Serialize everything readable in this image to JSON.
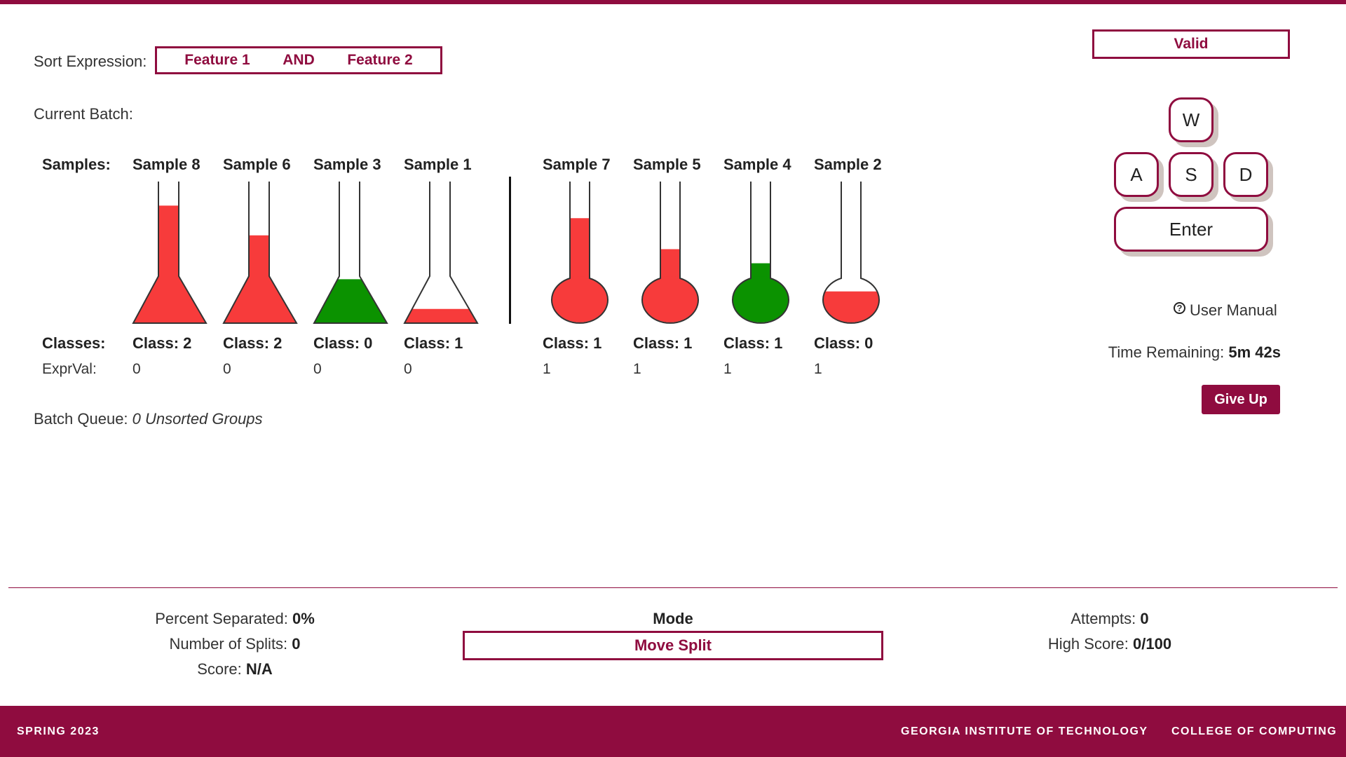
{
  "sort_expression": {
    "label": "Sort Expression:",
    "tokens": [
      "Feature 1",
      "AND",
      "Feature 2"
    ]
  },
  "batch": {
    "label": "Current Batch:",
    "samples_label": "Samples:",
    "classes_label": "Classes:",
    "exprval_label": "ExprVal:",
    "left_group": [
      {
        "name": "Sample 8",
        "class": "Class: 2",
        "exprval": "0",
        "shape": "cone",
        "color": "#f73b3b",
        "fill": 0.83
      },
      {
        "name": "Sample 6",
        "class": "Class: 2",
        "exprval": "0",
        "shape": "cone",
        "color": "#f73b3b",
        "fill": 0.62
      },
      {
        "name": "Sample 3",
        "class": "Class: 0",
        "exprval": "0",
        "shape": "cone",
        "color": "#0b9200",
        "fill": 0.31
      },
      {
        "name": "Sample 1",
        "class": "Class: 1",
        "exprval": "0",
        "shape": "cone",
        "color": "#f73b3b",
        "fill": 0.1
      }
    ],
    "right_group": [
      {
        "name": "Sample 7",
        "class": "Class: 1",
        "exprval": "1",
        "shape": "bulb",
        "color": "#f73b3b",
        "fill": 0.74
      },
      {
        "name": "Sample 5",
        "class": "Class: 1",
        "exprval": "1",
        "shape": "bulb",
        "color": "#f73b3b",
        "fill": 0.52
      },
      {
        "name": "Sample 4",
        "class": "Class: 1",
        "exprval": "1",
        "shape": "bulb",
        "color": "#0b9200",
        "fill": 0.42
      },
      {
        "name": "Sample 2",
        "class": "Class: 0",
        "exprval": "1",
        "shape": "bulb",
        "color": "#f73b3b",
        "fill": 0.22
      }
    ]
  },
  "queue": {
    "label": "Batch Queue:",
    "value": "0 Unsorted Groups"
  },
  "status": {
    "valid_label": "Valid"
  },
  "keys": {
    "w": "W",
    "a": "A",
    "s": "S",
    "d": "D",
    "enter": "Enter"
  },
  "manual": {
    "icon": "help-circle-icon",
    "label": "User Manual"
  },
  "timer": {
    "label": "Time Remaining:",
    "value": "5m 42s"
  },
  "give_up_label": "Give Up",
  "stats": {
    "percent_label": "Percent Separated:",
    "percent_value": "0%",
    "splits_label": "Number of Splits:",
    "splits_value": "0",
    "score_label": "Score:",
    "score_value": "N/A",
    "attempts_label": "Attempts:",
    "attempts_value": "0",
    "highscore_label": "High Score:",
    "highscore_value": "0/100"
  },
  "mode": {
    "title": "Mode",
    "value": "Move Split"
  },
  "footer": {
    "left": "SPRING 2023",
    "center": "GEORGIA INSTITUTE OF TECHNOLOGY",
    "right": "COLLEGE OF COMPUTING"
  },
  "colors": {
    "accent": "#8f0c3f",
    "red": "#f73b3b",
    "green": "#0b9200"
  }
}
